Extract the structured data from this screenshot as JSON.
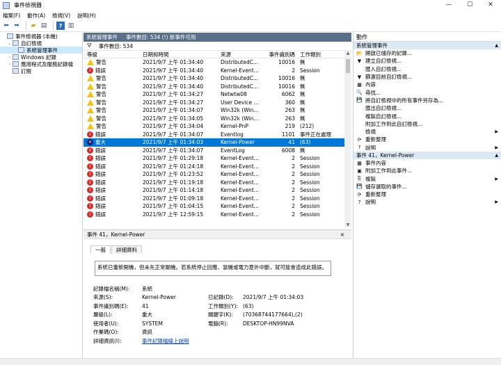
{
  "window": {
    "title": "事件檢視器",
    "min": "—",
    "max": "☐",
    "close": "✕"
  },
  "menu": [
    "檔案(F)",
    "動作(A)",
    "檢視(V)",
    "說明(H)"
  ],
  "tree": [
    {
      "label": "事件檢視器 (本機)",
      "indent": 0,
      "exp": "",
      "sel": false
    },
    {
      "label": "自訂檢視",
      "indent": 1,
      "exp": "⌄",
      "sel": false
    },
    {
      "label": "系統管理事件",
      "indent": 2,
      "exp": "",
      "sel": true
    },
    {
      "label": "Windows 記錄",
      "indent": 1,
      "exp": "›",
      "sel": false
    },
    {
      "label": "應用程式及服務記錄檔",
      "indent": 1,
      "exp": "›",
      "sel": false
    },
    {
      "label": "訂閱",
      "indent": 1,
      "exp": "",
      "sel": false
    }
  ],
  "center": {
    "title": "系統管理事件",
    "count_text": "事件數目: 534 (!) 新事件可用",
    "filter_text": "事件數目: 534",
    "columns": [
      "等級",
      "日期和時間",
      "來源",
      "事件識別碼",
      "工作類別"
    ]
  },
  "events": [
    {
      "lvl": "warn",
      "level": "警告",
      "time": "2021/9/7 上午 01:34:40",
      "src": "DistributedC...",
      "id": "10016",
      "cat": "無",
      "sel": false
    },
    {
      "lvl": "err",
      "level": "錯誤",
      "time": "2021/9/7 上午 01:34:40",
      "src": "Kernel-Event...",
      "id": "2",
      "cat": "Session",
      "sel": false
    },
    {
      "lvl": "warn",
      "level": "警告",
      "time": "2021/9/7 上午 01:34:40",
      "src": "DistributedC...",
      "id": "10016",
      "cat": "無",
      "sel": false
    },
    {
      "lvl": "warn",
      "level": "警告",
      "time": "2021/9/7 上午 01:34:40",
      "src": "DistributedC...",
      "id": "10016",
      "cat": "無",
      "sel": false
    },
    {
      "lvl": "warn",
      "level": "警告",
      "time": "2021/9/7 上午 01:34:27",
      "src": "Netwtw08",
      "id": "6062",
      "cat": "無",
      "sel": false
    },
    {
      "lvl": "warn",
      "level": "警告",
      "time": "2021/9/7 上午 01:34:27",
      "src": "User Device ...",
      "id": "360",
      "cat": "無",
      "sel": false
    },
    {
      "lvl": "warn",
      "level": "警告",
      "time": "2021/9/7 上午 01:34:07",
      "src": "Win32k (Win...",
      "id": "263",
      "cat": "無",
      "sel": false
    },
    {
      "lvl": "warn",
      "level": "警告",
      "time": "2021/9/7 上午 01:34:05",
      "src": "Win32k (Win...",
      "id": "263",
      "cat": "無",
      "sel": false
    },
    {
      "lvl": "warn",
      "level": "警告",
      "time": "2021/9/7 上午 01:34:04",
      "src": "Kernel-PnP",
      "id": "219",
      "cat": "(212)",
      "sel": false
    },
    {
      "lvl": "err",
      "level": "錯誤",
      "time": "2021/9/7 上午 01:34:07",
      "src": "Eventlog",
      "id": "1101",
      "cat": "事件正在處理",
      "sel": false
    },
    {
      "lvl": "crit",
      "level": "重大",
      "time": "2021/9/7 上午 01:34:03",
      "src": "Kernel-Power",
      "id": "41",
      "cat": "(63)",
      "sel": true
    },
    {
      "lvl": "err",
      "level": "錯誤",
      "time": "2021/9/7 上午 01:34:07",
      "src": "EventLog",
      "id": "6008",
      "cat": "無",
      "sel": false
    },
    {
      "lvl": "err",
      "level": "錯誤",
      "time": "2021/9/7 上午 01:29:18",
      "src": "Kernel-Event...",
      "id": "2",
      "cat": "Session",
      "sel": false
    },
    {
      "lvl": "err",
      "level": "錯誤",
      "time": "2021/9/7 上午 01:24:18",
      "src": "Kernel-Event...",
      "id": "2",
      "cat": "Session",
      "sel": false
    },
    {
      "lvl": "err",
      "level": "錯誤",
      "time": "2021/9/7 上午 01:23:52",
      "src": "Kernel-Event...",
      "id": "2",
      "cat": "Session",
      "sel": false
    },
    {
      "lvl": "err",
      "level": "錯誤",
      "time": "2021/9/7 上午 01:19:18",
      "src": "Kernel-Event...",
      "id": "2",
      "cat": "Session",
      "sel": false
    },
    {
      "lvl": "err",
      "level": "錯誤",
      "time": "2021/9/7 上午 01:14:18",
      "src": "Kernel-Event...",
      "id": "2",
      "cat": "Session",
      "sel": false
    },
    {
      "lvl": "err",
      "level": "錯誤",
      "time": "2021/9/7 上午 01:09:18",
      "src": "Kernel-Event...",
      "id": "2",
      "cat": "Session",
      "sel": false
    },
    {
      "lvl": "err",
      "level": "錯誤",
      "time": "2021/9/7 上午 01:04:15",
      "src": "Kernel-Event...",
      "id": "2",
      "cat": "Session",
      "sel": false
    },
    {
      "lvl": "err",
      "level": "錯誤",
      "time": "2021/9/7 上午 12:59:15",
      "src": "Kernel-Event...",
      "id": "2",
      "cat": "Session",
      "sel": false
    }
  ],
  "detail": {
    "title": "事件 41，Kernel-Power",
    "close": "×",
    "tabs": [
      "一般",
      "詳細資料"
    ],
    "message": "系統已重新開機，但未先正常關機。若系統停止回應、當機或電力意外中斷，就可能會造成此錯誤。",
    "props": [
      {
        "l": "記錄檔名稱(M):",
        "v": "系統",
        "l2": "",
        "v2": ""
      },
      {
        "l": "來源(S):",
        "v": "Kernel-Power",
        "l2": "已記錄(D):",
        "v2": "2021/9/7 上午 01:34:03"
      },
      {
        "l": "事件識別碼(E):",
        "v": "41",
        "l2": "工作類別(Y):",
        "v2": "(63)"
      },
      {
        "l": "層級(L):",
        "v": "重大",
        "l2": "關鍵字(K):",
        "v2": "(70368744177664),(2)"
      },
      {
        "l": "使用者(U):",
        "v": "SYSTEM",
        "l2": "電腦(R):",
        "v2": "DESKTOP-HN99NVA"
      },
      {
        "l": "作業碼(O):",
        "v": "資訊",
        "l2": "",
        "v2": ""
      }
    ],
    "more_label": "詳細資訊(I):",
    "more_link": "事件記錄檔線上說明"
  },
  "actions": {
    "title": "動作",
    "sec1": "系統管理事件",
    "items1": [
      {
        "icon": "📂",
        "label": "開啟已儲存的記錄...",
        "sub": false
      },
      {
        "icon": "▼",
        "label": "建立自訂檢視...",
        "sub": false
      },
      {
        "icon": "",
        "label": "匯入自訂檢視...",
        "sub": false
      },
      {
        "icon": "▼",
        "label": "篩選目前自訂檢視...",
        "sub": false
      },
      {
        "icon": "▦",
        "label": "內容",
        "sub": false
      },
      {
        "icon": "🔍",
        "label": "尋找...",
        "sub": false
      },
      {
        "icon": "💾",
        "label": "將自訂檢視中的所有事件另存為...",
        "sub": false
      },
      {
        "icon": "",
        "label": "匯出自訂檢視...",
        "sub": false
      },
      {
        "icon": "",
        "label": "複製自訂檢視...",
        "sub": false
      },
      {
        "icon": "",
        "label": "附加工作到此自訂檢視...",
        "sub": false
      },
      {
        "icon": "",
        "label": "檢視",
        "sub": true
      },
      {
        "icon": "⟳",
        "label": "重新整理",
        "sub": false
      },
      {
        "icon": "?",
        "label": "說明",
        "sub": true
      }
    ],
    "sec2": "事件 41，Kernel-Power",
    "items2": [
      {
        "icon": "▦",
        "label": "事件內容",
        "sub": false
      },
      {
        "icon": "▣",
        "label": "附加工作到此事件...",
        "sub": false
      },
      {
        "icon": "⎘",
        "label": "複製",
        "sub": true
      },
      {
        "icon": "💾",
        "label": "儲存選取的事件...",
        "sub": false
      },
      {
        "icon": "⟳",
        "label": "重新整理",
        "sub": false
      },
      {
        "icon": "?",
        "label": "說明",
        "sub": true
      }
    ]
  }
}
